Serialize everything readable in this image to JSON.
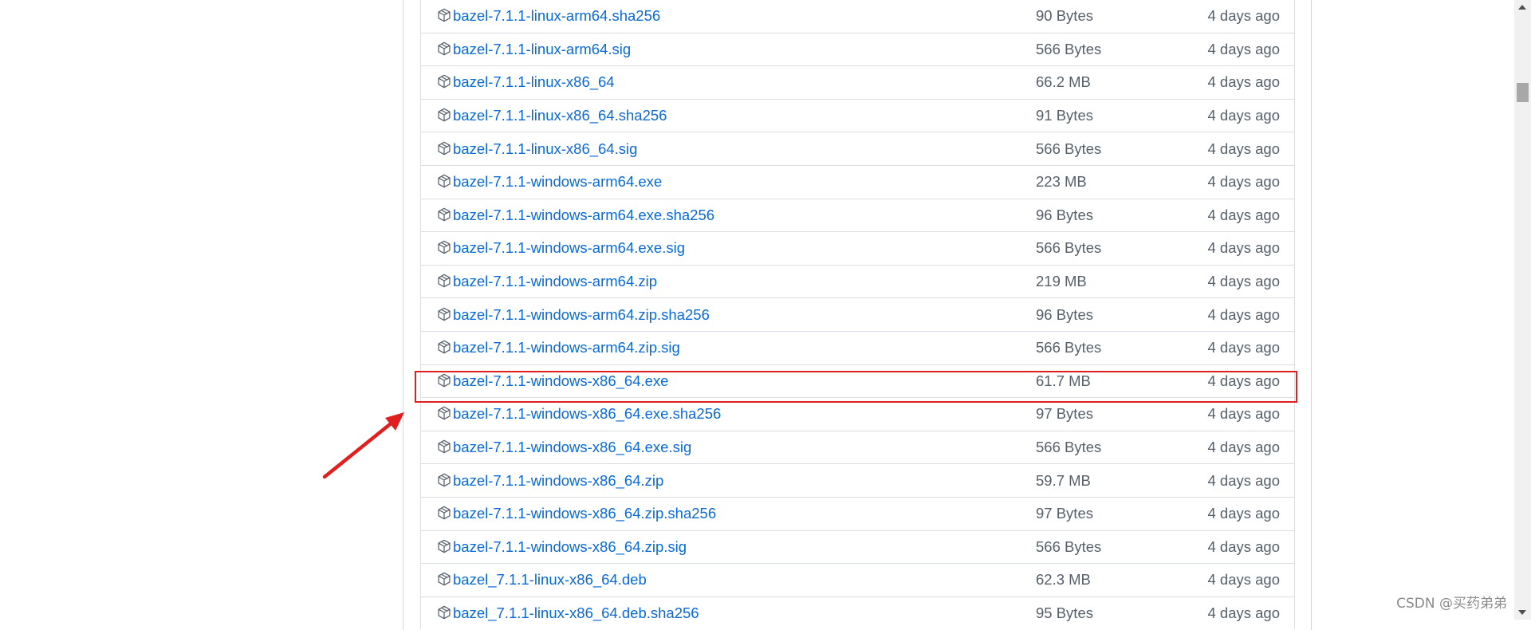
{
  "assets": [
    {
      "name": "bazel-7.1.1-linux-arm64.sha256",
      "size": "90 Bytes",
      "date": "4 days ago"
    },
    {
      "name": "bazel-7.1.1-linux-arm64.sig",
      "size": "566 Bytes",
      "date": "4 days ago"
    },
    {
      "name": "bazel-7.1.1-linux-x86_64",
      "size": "66.2 MB",
      "date": "4 days ago"
    },
    {
      "name": "bazel-7.1.1-linux-x86_64.sha256",
      "size": "91 Bytes",
      "date": "4 days ago"
    },
    {
      "name": "bazel-7.1.1-linux-x86_64.sig",
      "size": "566 Bytes",
      "date": "4 days ago"
    },
    {
      "name": "bazel-7.1.1-windows-arm64.exe",
      "size": "223 MB",
      "date": "4 days ago"
    },
    {
      "name": "bazel-7.1.1-windows-arm64.exe.sha256",
      "size": "96 Bytes",
      "date": "4 days ago"
    },
    {
      "name": "bazel-7.1.1-windows-arm64.exe.sig",
      "size": "566 Bytes",
      "date": "4 days ago"
    },
    {
      "name": "bazel-7.1.1-windows-arm64.zip",
      "size": "219 MB",
      "date": "4 days ago"
    },
    {
      "name": "bazel-7.1.1-windows-arm64.zip.sha256",
      "size": "96 Bytes",
      "date": "4 days ago"
    },
    {
      "name": "bazel-7.1.1-windows-arm64.zip.sig",
      "size": "566 Bytes",
      "date": "4 days ago"
    },
    {
      "name": "bazel-7.1.1-windows-x86_64.exe",
      "size": "61.7 MB",
      "date": "4 days ago"
    },
    {
      "name": "bazel-7.1.1-windows-x86_64.exe.sha256",
      "size": "97 Bytes",
      "date": "4 days ago"
    },
    {
      "name": "bazel-7.1.1-windows-x86_64.exe.sig",
      "size": "566 Bytes",
      "date": "4 days ago"
    },
    {
      "name": "bazel-7.1.1-windows-x86_64.zip",
      "size": "59.7 MB",
      "date": "4 days ago"
    },
    {
      "name": "bazel-7.1.1-windows-x86_64.zip.sha256",
      "size": "97 Bytes",
      "date": "4 days ago"
    },
    {
      "name": "bazel-7.1.1-windows-x86_64.zip.sig",
      "size": "566 Bytes",
      "date": "4 days ago"
    },
    {
      "name": "bazel_7.1.1-linux-x86_64.deb",
      "size": "62.3 MB",
      "date": "4 days ago"
    },
    {
      "name": "bazel_7.1.1-linux-x86_64.deb.sha256",
      "size": "95 Bytes",
      "date": "4 days ago"
    }
  ],
  "highlighted_asset": "bazel-7.1.1-windows-x86_64.exe",
  "icons": {
    "asset": "package-icon",
    "annotation": "red-arrow"
  },
  "colors": {
    "link": "#0969da",
    "muted": "#57606a",
    "highlight": "#e02020"
  },
  "watermark": "CSDN @买药弟弟"
}
